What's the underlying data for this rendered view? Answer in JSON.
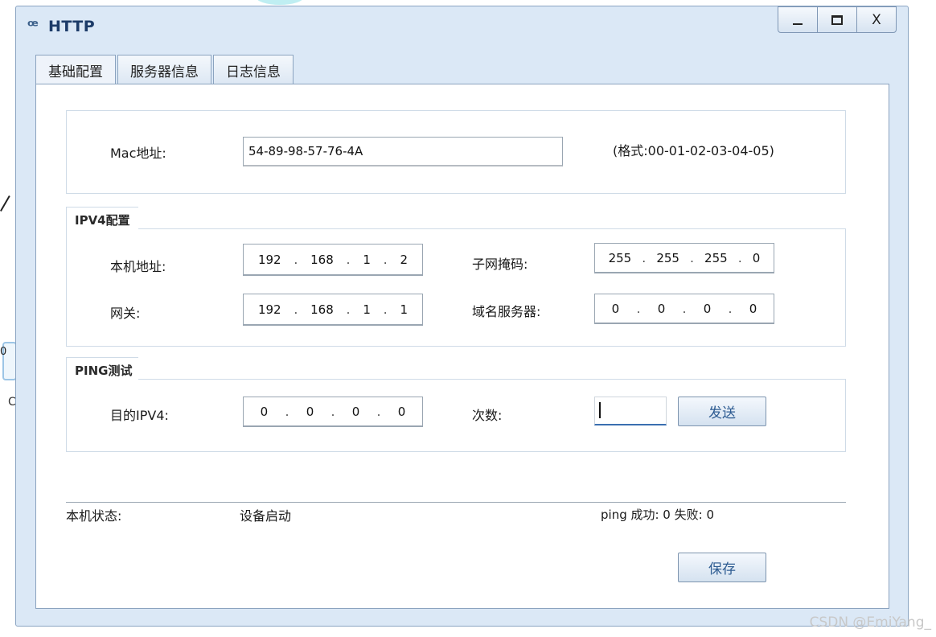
{
  "window": {
    "title": "HTTP",
    "app_icon": "app-icon",
    "controls": {
      "minimize": "minimize-icon",
      "maximize": "maximize-icon",
      "close": "X"
    }
  },
  "tabs": [
    {
      "label": "基础配置",
      "active": true
    },
    {
      "label": "服务器信息",
      "active": false
    },
    {
      "label": "日志信息",
      "active": false
    }
  ],
  "mac": {
    "label": "Mac地址:",
    "value": "54-89-98-57-76-4A",
    "hint": "(格式:00-01-02-03-04-05)"
  },
  "ipv4": {
    "legend": "IPV4配置",
    "local_label": "本机地址:",
    "local_ip": [
      "192",
      "168",
      "1",
      "2"
    ],
    "mask_label": "子网掩码:",
    "mask": [
      "255",
      "255",
      "255",
      "0"
    ],
    "gateway_label": "网关:",
    "gateway": [
      "192",
      "168",
      "1",
      "1"
    ],
    "dns_label": "域名服务器:",
    "dns": [
      "0",
      "0",
      "0",
      "0"
    ]
  },
  "ping": {
    "legend": "PING测试",
    "dest_label": "目的IPV4:",
    "dest": [
      "0",
      "0",
      "0",
      "0"
    ],
    "count_label": "次数:",
    "count_value": "",
    "send_label": "发送"
  },
  "status": {
    "label": "本机状态:",
    "value": "设备启动",
    "ping_result": "ping 成功: 0 失败: 0"
  },
  "save_label": "保存",
  "watermark": "CSDN @EmiYang_",
  "background": {
    "label_0": "0",
    "label_c": "C"
  },
  "colors": {
    "window_bg": "#dbe8f6",
    "title": "#1c3b68",
    "button_text": "#2e5c92",
    "focus": "#3a6fb0"
  }
}
